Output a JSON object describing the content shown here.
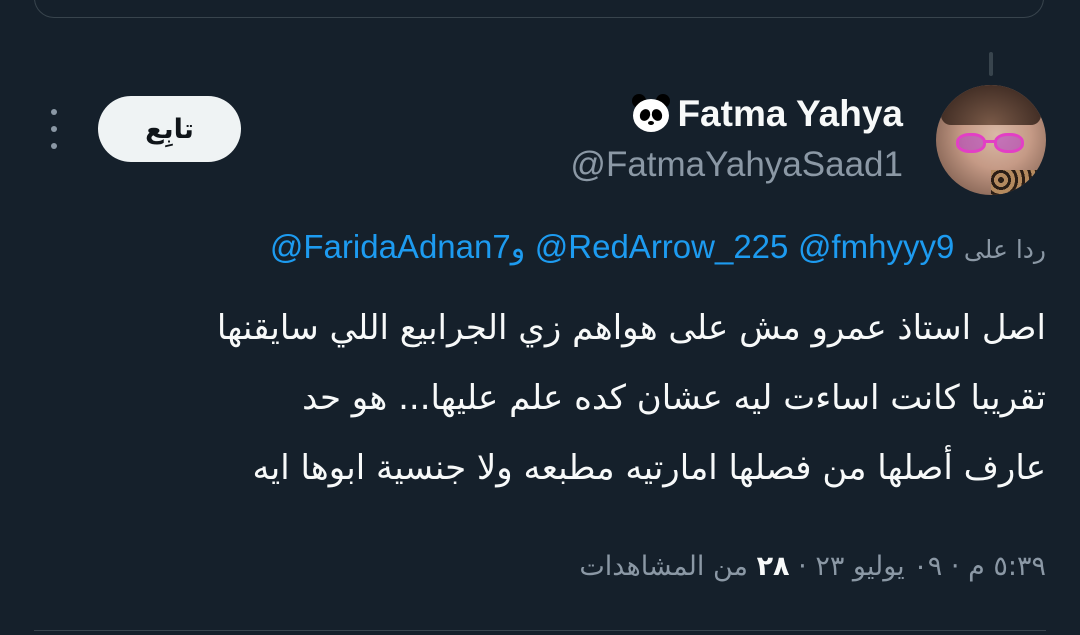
{
  "tweet": {
    "author": {
      "display_name": "Fatma Yahya",
      "handle": "@FatmaYahyaSaad1",
      "name_emoji": "panda-face-icon"
    },
    "follow_label": "تابِع",
    "reply_prefix": "ردا على",
    "reply_mentions": [
      "@fmhyyy9",
      "@RedArrow_225",
      "@FaridaAdnan7"
    ],
    "reply_conjunction": "و",
    "body_lines": [
      "اصل استاذ عمرو مش على هواهم زي الجرابيع اللي سايقنها",
      "تقريبا كانت اساءت ليه عشان كده علم عليها... هو حد",
      "عارف أصلها من فصلها امارتيه مطبعه ولا جنسية ابوها ايه"
    ],
    "time": "٥:٣٩ م",
    "date": "٠٩ يوليو ٢٣",
    "separator": "·",
    "views_count": "٢٨",
    "views_label": "من المشاهدات"
  },
  "colors": {
    "background": "#15202b",
    "text": "#f7f9f9",
    "secondary_text": "#8b98a5",
    "link": "#1d9bf0",
    "border": "#38444d",
    "follow_button_bg": "#eff3f4"
  }
}
